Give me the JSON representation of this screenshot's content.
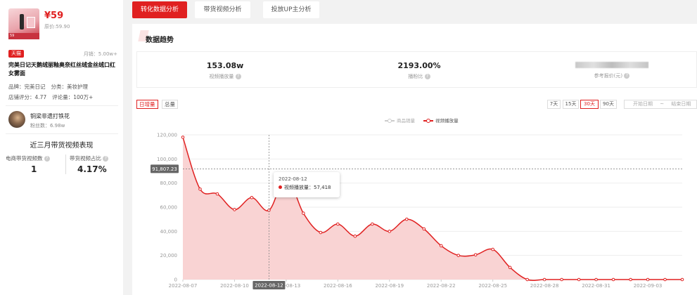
{
  "product": {
    "price": "¥59",
    "original_price": "原价:59.90",
    "thumbnail_label": "59",
    "platform_tag": "天猫",
    "monthly_sales": "月销：5.00w+",
    "title": "完美日记天鹅绒丽釉奥奈红丝绒金丝绒口红女雾面",
    "brand": "品牌：完美日记",
    "category": "分类：美妆护理",
    "store_rating": "店铺评分：4.77",
    "review_count": "评论量：100万+"
  },
  "influencer": {
    "name": "铜梁非遗打铁花",
    "fans": "粉丝数：6.98w"
  },
  "three_month": {
    "title": "近三月带货视频表现",
    "ecom_videos_label": "电商带货视频数",
    "ecom_videos_value": "1",
    "share_label": "带货视频占比",
    "share_value": "4.17%"
  },
  "tabs": [
    {
      "label": "转化数据分析",
      "active": true
    },
    {
      "label": "带货视频分析",
      "active": false
    },
    {
      "label": "投放UP主分析",
      "active": false
    }
  ],
  "trend": {
    "title": "数据趋势",
    "stats": [
      {
        "value": "153.08w",
        "label": "视频播放量"
      },
      {
        "value": "2193.00%",
        "label": "播粉比"
      },
      {
        "value": "",
        "label": "参考报价(元)"
      }
    ],
    "mode_tabs": [
      {
        "label": "日增量",
        "active": true
      },
      {
        "label": "总量",
        "active": false
      }
    ],
    "date_buttons": [
      {
        "label": "7天",
        "active": false
      },
      {
        "label": "15天",
        "active": false
      },
      {
        "label": "30天",
        "active": true
      },
      {
        "label": "90天",
        "active": false
      }
    ],
    "date_start_placeholder": "开始日期",
    "date_separator": "~",
    "date_end_placeholder": "结束日期"
  },
  "tooltip": {
    "date": "2022-08-12",
    "series": "视频播放量",
    "value": "57,418"
  },
  "colors": {
    "accent": "#e02020",
    "area_fill": "#f9d3d3",
    "muted_series": "#cccccc"
  },
  "chart_data": {
    "type": "area",
    "legend": [
      "商品销量",
      "视频播放量"
    ],
    "legend_colors": [
      "#cccccc",
      "#e02020"
    ],
    "x": [
      "2022-08-07",
      "2022-08-08",
      "2022-08-09",
      "2022-08-10",
      "2022-08-11",
      "2022-08-12",
      "2022-08-13",
      "2022-08-14",
      "2022-08-15",
      "2022-08-16",
      "2022-08-17",
      "2022-08-18",
      "2022-08-19",
      "2022-08-20",
      "2022-08-21",
      "2022-08-22",
      "2022-08-23",
      "2022-08-24",
      "2022-08-25",
      "2022-08-26",
      "2022-08-27",
      "2022-08-28",
      "2022-08-29",
      "2022-08-30",
      "2022-08-31",
      "2022-09-01",
      "2022-09-02",
      "2022-09-03",
      "2022-09-04",
      "2022-09-05"
    ],
    "x_tick_labels": [
      "2022-08-07",
      "2022-08-10",
      "2022-08-13",
      "2022-08-16",
      "2022-08-19",
      "2022-08-22",
      "2022-08-25",
      "2022-08-28",
      "2022-08-31",
      "2022-09-03"
    ],
    "series": [
      {
        "name": "视频播放量",
        "values": [
          118000,
          75000,
          71000,
          58000,
          68000,
          57418,
          85000,
          55000,
          39000,
          46000,
          36000,
          46000,
          40000,
          50000,
          42000,
          28000,
          20000,
          20500,
          25000,
          10000,
          0,
          0,
          0,
          0,
          0,
          0,
          0,
          0,
          0,
          0
        ]
      }
    ],
    "yticks": [
      0,
      20000,
      40000,
      60000,
      80000,
      100000,
      120000
    ],
    "ytick_labels": [
      "0",
      "20,000",
      "40,000",
      "60,000",
      "80,000",
      "100,000",
      "120,000"
    ],
    "ylim": [
      0,
      120000
    ],
    "reference_line": {
      "value": 91807.23,
      "label": "91,807.23"
    },
    "crosshair_x": "2022-08-12",
    "grid": true
  }
}
